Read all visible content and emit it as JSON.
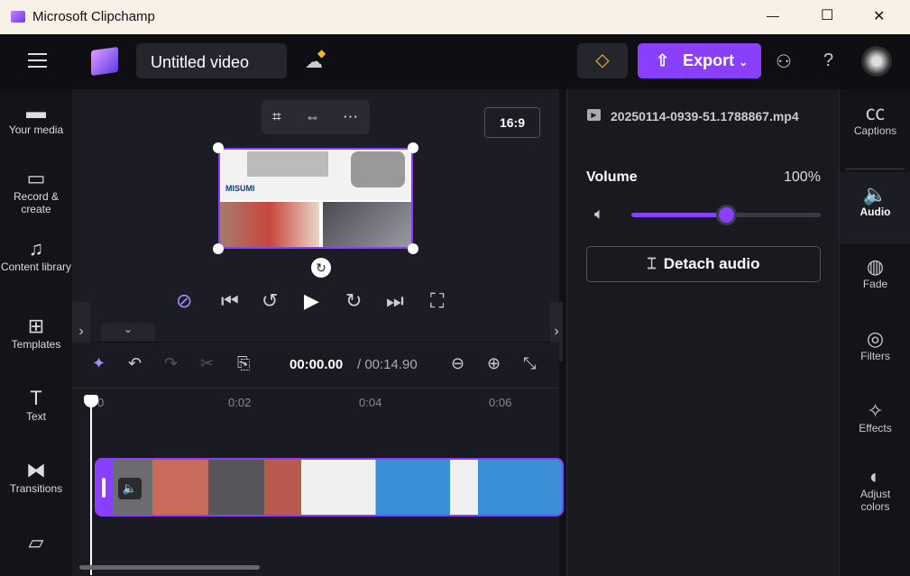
{
  "window": {
    "title": "Microsoft Clipchamp",
    "minimize": "—",
    "maximize": "☐",
    "close": "✕"
  },
  "topbar": {
    "project_name": "Untitled video",
    "export_label": "Export",
    "help": "?"
  },
  "left_sidebar": [
    {
      "label": "Your media",
      "icon": "folder-icon",
      "glyph": "▬"
    },
    {
      "label": "Record & create",
      "icon": "camera-icon",
      "glyph": "▭"
    },
    {
      "label": "Content library",
      "icon": "library-icon",
      "glyph": "♫"
    },
    {
      "label": "Templates",
      "icon": "templates-icon",
      "glyph": "⊞"
    },
    {
      "label": "Text",
      "icon": "text-icon",
      "glyph": "T"
    },
    {
      "label": "Transitions",
      "icon": "transitions-icon",
      "glyph": "⧓"
    },
    {
      "label": "",
      "icon": "brand-kit-icon",
      "glyph": "▱"
    }
  ],
  "preview": {
    "aspect_ratio": "16:9",
    "thumb_brand": "MISUMI"
  },
  "timeline": {
    "current_time": "00:00.00",
    "total_time": "/ 00:14.90",
    "ticks": [
      "0",
      "0:02",
      "0:04",
      "0:06"
    ]
  },
  "properties": {
    "file_name": "20250114-0939-51.1788867.mp4",
    "volume_label": "Volume",
    "volume_value": "100%",
    "volume_fraction": 0.5,
    "detach_label": "Detach audio"
  },
  "right_sidebar": [
    {
      "label": "Captions",
      "icon": "captions-icon",
      "glyph": "㏄"
    },
    {
      "label": "Audio",
      "icon": "speaker-icon",
      "glyph": "🔈",
      "active": true
    },
    {
      "label": "Fade",
      "icon": "fade-icon",
      "glyph": "◍"
    },
    {
      "label": "Filters",
      "icon": "filters-icon",
      "glyph": "◎"
    },
    {
      "label": "Effects",
      "icon": "magic-wand-icon",
      "glyph": "✧"
    },
    {
      "label": "Adjust colors",
      "icon": "adjust-colors-icon",
      "glyph": "◐"
    }
  ],
  "colors": {
    "accent": "#8a3ffc",
    "bg": "#101015"
  }
}
